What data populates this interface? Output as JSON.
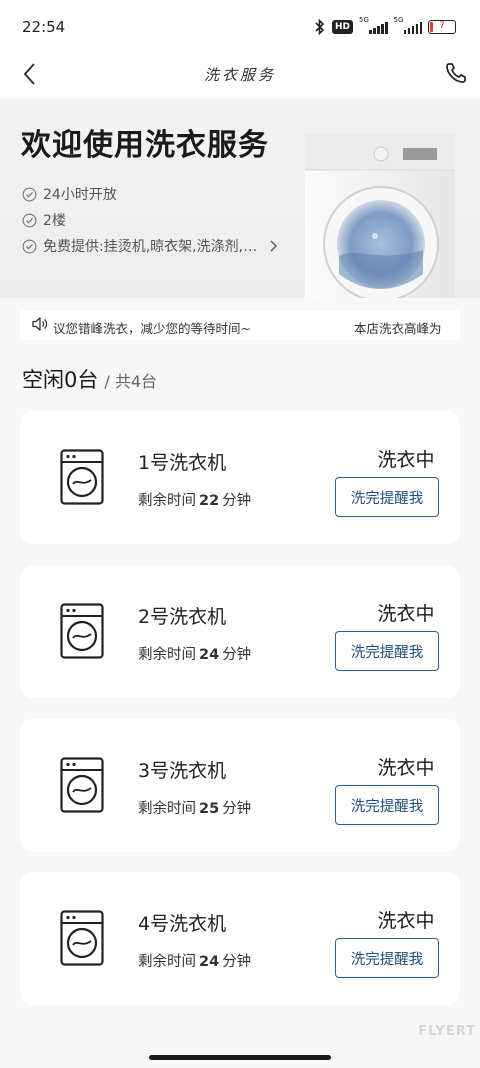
{
  "status_bar": {
    "time": "22:54",
    "hd_label": "HD",
    "network_labels": [
      "5G",
      "5G"
    ],
    "battery_level": "7"
  },
  "header": {
    "title": "洗衣服务"
  },
  "hero": {
    "title": "欢迎使用洗衣服务",
    "features": [
      "24小时开放",
      "2楼",
      "免费提供:挂烫机,晾衣架,洗涤剂,…"
    ]
  },
  "notice": {
    "text": "议您错峰洗衣，减少您的等待时间~",
    "text_continued": "本店洗衣高峰为"
  },
  "summary": {
    "idle_label": "空闲0台",
    "total_label": "/ 共4台"
  },
  "machines": [
    {
      "name": "1号洗衣机",
      "remain_prefix": "剩余时间",
      "remain_value": "22",
      "remain_unit": "分钟",
      "status": "洗衣中",
      "action": "洗完提醒我"
    },
    {
      "name": "2号洗衣机",
      "remain_prefix": "剩余时间",
      "remain_value": "24",
      "remain_unit": "分钟",
      "status": "洗衣中",
      "action": "洗完提醒我"
    },
    {
      "name": "3号洗衣机",
      "remain_prefix": "剩余时间",
      "remain_value": "25",
      "remain_unit": "分钟",
      "status": "洗衣中",
      "action": "洗完提醒我"
    },
    {
      "name": "4号洗衣机",
      "remain_prefix": "剩余时间",
      "remain_value": "24",
      "remain_unit": "分钟",
      "status": "洗衣中",
      "action": "洗完提醒我"
    }
  ],
  "watermark": "FLYERT",
  "colors": {
    "accent": "#1e4e80",
    "background": "#f7f7f7",
    "card": "#ffffff",
    "battery_low": "#e53935"
  },
  "icons": [
    "back-icon",
    "phone-icon",
    "check-icon",
    "chevron-right-icon",
    "speaker-icon",
    "washing-machine-icon",
    "bluetooth-icon"
  ]
}
